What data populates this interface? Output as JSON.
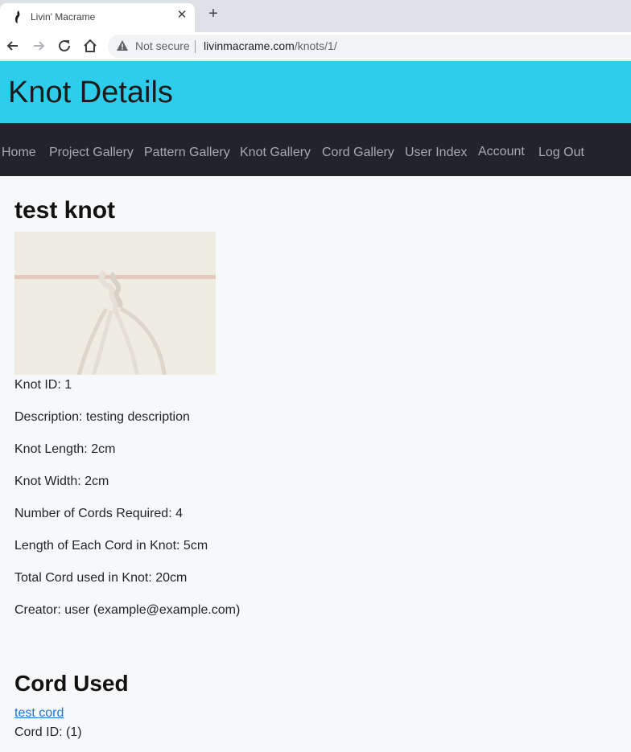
{
  "browser": {
    "tab_title": "Livin' Macrame",
    "tab_close": "✕",
    "new_tab": "+",
    "security_label": "Not secure",
    "url_host": "livinmacrame.com",
    "url_path": "/knots/1/"
  },
  "header": {
    "title": "Knot Details"
  },
  "nav": {
    "items": [
      {
        "label": "Home"
      },
      {
        "label": "Project Gallery"
      },
      {
        "label": "Pattern Gallery"
      },
      {
        "label": "Knot Gallery"
      },
      {
        "label": "Cord Gallery"
      },
      {
        "label": "User Index"
      },
      {
        "label": "Account"
      },
      {
        "label": "Log Out"
      }
    ]
  },
  "knot": {
    "name": "test knot",
    "details": [
      "Knot ID: 1",
      "Description: testing description",
      "Knot Length: 2cm",
      "Knot Width: 2cm",
      "Number of Cords Required: 4",
      "Length of Each Cord in Knot: 5cm",
      "Total Cord used in Knot: 20cm",
      "Creator: user (example@example.com)"
    ]
  },
  "cord_section": {
    "heading": "Cord Used",
    "link_text": "test cord",
    "cord_id": "Cord ID: (1)"
  },
  "colors": {
    "header_bg": "#2ecdeb",
    "navbar_bg": "#212529",
    "page_bg": "#f7f8fa",
    "link": "#1a73e8"
  }
}
